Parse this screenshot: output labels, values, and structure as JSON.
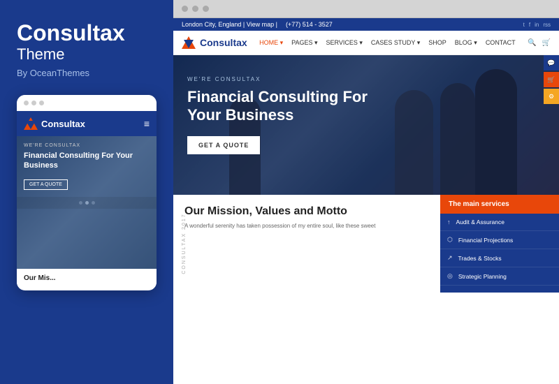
{
  "left": {
    "title": "Consultax",
    "subtitle": "Theme",
    "by": "By OceanThemes"
  },
  "mobile": {
    "logo": "Consultax",
    "hero_label": "WE'RE CONSULTAX",
    "hero_title": "Financial Consulting For Your Business",
    "hero_btn": "GET A QUOTE",
    "mission_label": "Our Mis...",
    "dots": [
      "",
      "",
      ""
    ]
  },
  "site": {
    "topbar": {
      "location": "London City, England | View map |",
      "phone": "(+77) 514 - 3527",
      "social": [
        "t",
        "f",
        "in",
        "rss"
      ]
    },
    "nav": {
      "logo": "Consultax",
      "links": [
        "HOME",
        "PAGES",
        "SERVICES",
        "CASES STUDY",
        "SHOP",
        "BLOG",
        "CONTACT"
      ],
      "active": "HOME"
    },
    "hero": {
      "label": "WE'RE CONSULTAX",
      "title": "Financial Consulting For Your Business",
      "btn": "GET A QUOTE"
    },
    "mission": {
      "side_label": "CONSULTAX 2017",
      "title": "Our Mission, Values and Motto",
      "text": "A wonderful serenity has taken possession of my entire soul, like these sweet"
    },
    "services": {
      "header": "The main services",
      "items": [
        {
          "icon": "↑",
          "label": "Audit & Assurance"
        },
        {
          "icon": "⬡",
          "label": "Financial Projections"
        },
        {
          "icon": "↗",
          "label": "Trades & Stocks"
        },
        {
          "icon": "◎",
          "label": "Strategic Planning"
        }
      ]
    },
    "floating": [
      "💬",
      "🛒",
      "⚙"
    ]
  }
}
